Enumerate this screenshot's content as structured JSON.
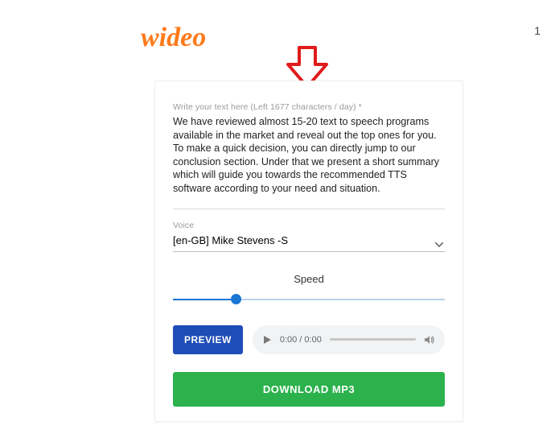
{
  "brand": {
    "name": "wideo"
  },
  "header": {
    "right_text": "1"
  },
  "form": {
    "text_field": {
      "label": "Write your text here (Left 1677 characters / day) *",
      "value": "We have reviewed almost 15-20 text to speech programs available in the market and reveal out the top ones for you. To make a quick decision, you can directly jump to our conclusion section. Under that we present a short summary which will guide you towards the recommended TTS software according to your need and situation."
    },
    "voice": {
      "label": "Voice",
      "selected": "[en-GB] Mike Stevens -S"
    },
    "speed": {
      "label": "Speed",
      "value": 0.22
    }
  },
  "audio": {
    "time_display": "0:00 / 0:00"
  },
  "buttons": {
    "preview": "PREVIEW",
    "download": "DOWNLOAD MP3"
  },
  "colors": {
    "brand_orange": "#ff7a1a",
    "primary_blue": "#1e4db7",
    "accent_green": "#2bb24c",
    "annotation_red": "#e01b1b"
  }
}
